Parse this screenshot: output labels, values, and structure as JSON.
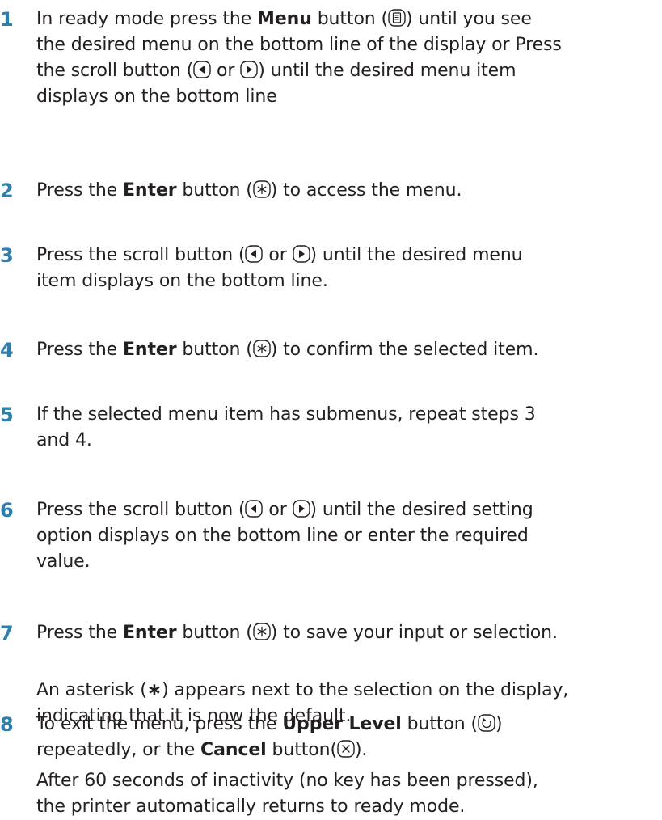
{
  "steps": [
    {
      "num": "1",
      "lines": [
        [
          "In ready mode press the ",
          {
            "b": "Menu"
          },
          " button (",
          {
            "icon": "menu-button-icon"
          },
          ") until you see"
        ],
        [
          "the desired menu on the bottom line of the display or Press"
        ],
        [
          "the scroll button (",
          {
            "icon": "scroll-left-icon"
          },
          " or ",
          {
            "icon": "scroll-right-icon"
          },
          ") until the desired menu item"
        ],
        [
          "displays on the bottom line"
        ]
      ]
    },
    {
      "num": "2",
      "lines": [
        [
          "Press the ",
          {
            "b": "Enter"
          },
          " button (",
          {
            "icon": "enter-button-icon"
          },
          ") to access the menu."
        ]
      ]
    },
    {
      "num": "3",
      "lines": [
        [
          "Press the scroll button (",
          {
            "icon": "scroll-left-icon"
          },
          " or ",
          {
            "icon": "scroll-right-icon"
          },
          ") until the desired menu"
        ],
        [
          "item displays on the bottom line."
        ]
      ]
    },
    {
      "num": "4",
      "lines": [
        [
          "Press the ",
          {
            "b": "Enter"
          },
          " button (",
          {
            "icon": "enter-button-icon"
          },
          ") to confirm the selected item."
        ]
      ]
    },
    {
      "num": "5",
      "lines": [
        [
          "If the selected menu item has submenus, repeat steps 3"
        ],
        [
          "and 4."
        ]
      ]
    },
    {
      "num": "6",
      "lines": [
        [
          "Press the scroll button (",
          {
            "icon": "scroll-left-icon"
          },
          " or ",
          {
            "icon": "scroll-right-icon"
          },
          ") until the desired setting"
        ],
        [
          "option displays on the bottom line or enter the required"
        ],
        [
          "value."
        ]
      ]
    },
    {
      "num": "7",
      "lines": [
        [
          "Press the ",
          {
            "b": "Enter"
          },
          " button (",
          {
            "icon": "enter-button-icon"
          },
          ") to save your input or selection."
        ]
      ],
      "note": [
        [
          "An asterisk (",
          {
            "b": "∗"
          },
          ") appears next to the selection on the display,"
        ],
        [
          "indicating that it is now the default."
        ]
      ]
    },
    {
      "num": "8",
      "lines": [
        [
          "To exit the menu, press the ",
          {
            "b": "Upper Level"
          },
          " button (",
          {
            "icon": "upper-level-button-icon"
          },
          ")"
        ],
        [
          "repeatedly, or the ",
          {
            "b": "Cancel"
          },
          " button(",
          {
            "icon": "cancel-button-icon"
          },
          ")."
        ]
      ],
      "note": [
        [
          "After 60 seconds of inactivity (no key has been pressed),"
        ],
        [
          "the printer automatically returns to ready mode."
        ]
      ]
    }
  ]
}
